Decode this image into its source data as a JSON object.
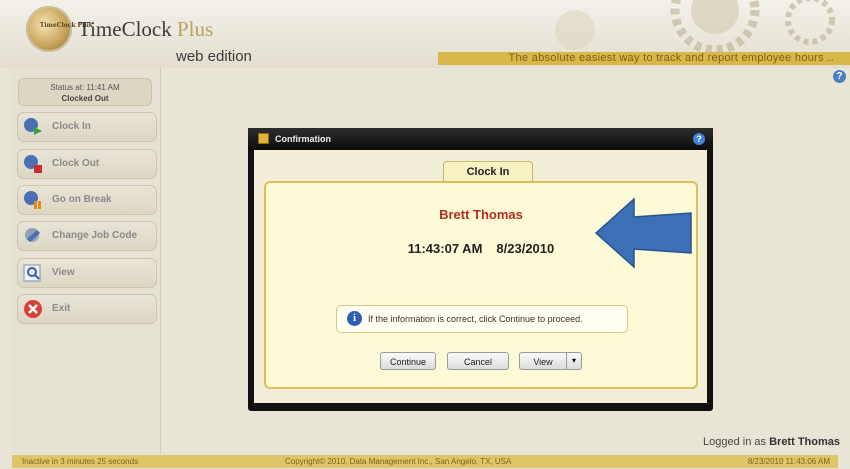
{
  "header": {
    "logo_text": "TimeClock Plus",
    "brand_main": "TimeClock",
    "brand_plus": "Plus",
    "edition": "web edition",
    "tagline": "The absolute easiest way to track and report employee hours ..",
    "help": "?"
  },
  "sidebar": {
    "status_line1": "Status at: 11:41 AM",
    "status_line2": "Clocked Out",
    "items": [
      {
        "label": "Clock In",
        "icon": "clock-in-icon"
      },
      {
        "label": "Clock Out",
        "icon": "clock-out-icon"
      },
      {
        "label": "Go on Break",
        "icon": "break-icon"
      },
      {
        "label": "Change Job Code",
        "icon": "job-code-icon"
      },
      {
        "label": "View",
        "icon": "view-icon"
      },
      {
        "label": "Exit",
        "icon": "exit-icon"
      }
    ]
  },
  "dialog": {
    "title": "Confirmation",
    "help": "?",
    "tab": "Clock In",
    "employee": "Brett Thomas",
    "time": "11:43:07 AM",
    "date": "8/23/2010",
    "info_icon": "i",
    "info": "If the information is correct, click Continue to proceed.",
    "buttons": {
      "continue": "Continue",
      "cancel": "Cancel",
      "view": "View",
      "caret": "▾"
    }
  },
  "footer": {
    "logged_prefix": "Logged in as",
    "logged_user": "Brett Thomas",
    "inactive": "Inactive in 3 minutes 25 seconds",
    "copyright": "Copyright© 2010, Data Management Inc., San Angelo, TX, USA",
    "datetime": "8/23/2010 11:43:06 AM"
  },
  "colors": {
    "accent": "#d9b84a",
    "employee_name": "#b1301f",
    "arrow": "#3b6fb6"
  }
}
